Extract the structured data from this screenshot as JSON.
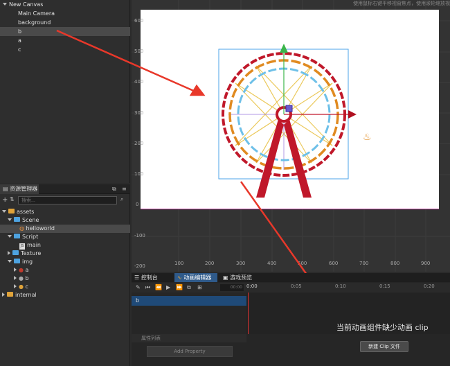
{
  "hierarchy": {
    "items": [
      {
        "label": "New Canvas"
      },
      {
        "label": "Main Camera"
      },
      {
        "label": "background"
      },
      {
        "label": "b"
      },
      {
        "label": "a"
      },
      {
        "label": "c"
      }
    ]
  },
  "assets": {
    "tab_label": "资源管理器",
    "search_placeholder": "搜索...",
    "items": [
      {
        "label": "assets"
      },
      {
        "label": "Scene"
      },
      {
        "label": "helloworld"
      },
      {
        "label": "Script"
      },
      {
        "label": "main"
      },
      {
        "label": "Texture"
      },
      {
        "label": "img"
      },
      {
        "label": "a"
      },
      {
        "label": "b"
      },
      {
        "label": "c"
      },
      {
        "label": "internal"
      }
    ]
  },
  "scene": {
    "hint": "使用鼠标右键平移视窗焦点，使用滚轮缩放视",
    "y_ticks": [
      "600",
      "500",
      "400",
      "300",
      "200",
      "100",
      "0",
      "-100",
      "-200"
    ],
    "x_ticks": [
      "100",
      "200",
      "300",
      "400",
      "500",
      "600",
      "700",
      "800",
      "900"
    ]
  },
  "bottom": {
    "tabs": [
      {
        "label": "控制台"
      },
      {
        "label": "动画编辑器"
      },
      {
        "label": "游戏预览"
      }
    ],
    "timeline_ticks": [
      "0:00",
      "0:05",
      "0:10",
      "0:15",
      "0:20"
    ],
    "frame_value": "00:00",
    "node_name": "b",
    "missing_clip": "当前动画组件缺少动画 clip",
    "props_label": "属性列表",
    "add_property": "Add Property",
    "new_clip": "新建 Clip 文件"
  },
  "colors": {
    "accent": "#2f5a8a",
    "arrow": "#e8382a"
  }
}
